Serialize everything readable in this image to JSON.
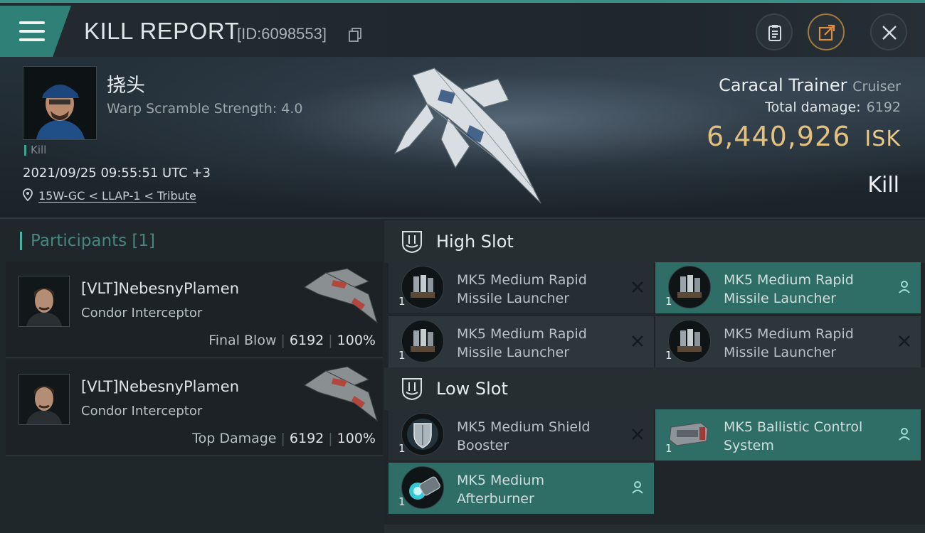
{
  "header": {
    "title": "KILL REPORT",
    "id_label": "[ID:6098553]"
  },
  "victim": {
    "name": "挠头",
    "detail": "Warp Scramble Strength: 4.0",
    "tag": "Kill",
    "datetime": "2021/09/25 09:55:51 UTC +3",
    "location": "15W-GC < LLAP-1 < Tribute",
    "ship_name": "Caracal Trainer",
    "ship_class": "Cruiser",
    "total_damage_label": "Total damage:",
    "total_damage": "6192",
    "isk_value": "6,440,926",
    "isk_unit": "ISK",
    "result": "Kill"
  },
  "participants": {
    "title": "Participants",
    "count": "[1]",
    "items": [
      {
        "name": "[VLT]NebesnyPlamen",
        "ship": "Condor Interceptor",
        "label": "Final Blow",
        "damage": "6192",
        "percent": "100%"
      },
      {
        "name": "[VLT]NebesnyPlamen",
        "ship": "Condor Interceptor",
        "label": "Top Damage",
        "damage": "6192",
        "percent": "100%"
      }
    ]
  },
  "slots": [
    {
      "label": "High Slot",
      "modules": [
        {
          "name": "MK5 Medium Rapid Missile Launcher",
          "qty": "1",
          "status": "destroyed",
          "icon": "missile-launcher-icon"
        },
        {
          "name": "MK5 Medium Rapid Missile Launcher",
          "qty": "1",
          "status": "dropped",
          "icon": "missile-launcher-icon"
        },
        {
          "name": "MK5 Medium Rapid Missile Launcher",
          "qty": "1",
          "status": "destroyed",
          "icon": "missile-launcher-icon"
        },
        {
          "name": "MK5 Medium Rapid Missile Launcher",
          "qty": "1",
          "status": "destroyed",
          "icon": "missile-launcher-icon"
        }
      ]
    },
    {
      "label": "Low Slot",
      "modules": [
        {
          "name": "MK5 Medium Shield Booster",
          "qty": "1",
          "status": "destroyed",
          "icon": "shield-booster-icon"
        },
        {
          "name": "MK5 Ballistic Control System",
          "qty": "1",
          "status": "dropped",
          "icon": "ballistic-control-icon"
        },
        {
          "name": "MK5 Medium Afterburner",
          "qty": "1",
          "status": "dropped",
          "icon": "afterburner-icon"
        }
      ]
    }
  ],
  "colors": {
    "accent": "#2f8177",
    "dropped": "#2f6e67",
    "isk": "#e2c07e"
  }
}
